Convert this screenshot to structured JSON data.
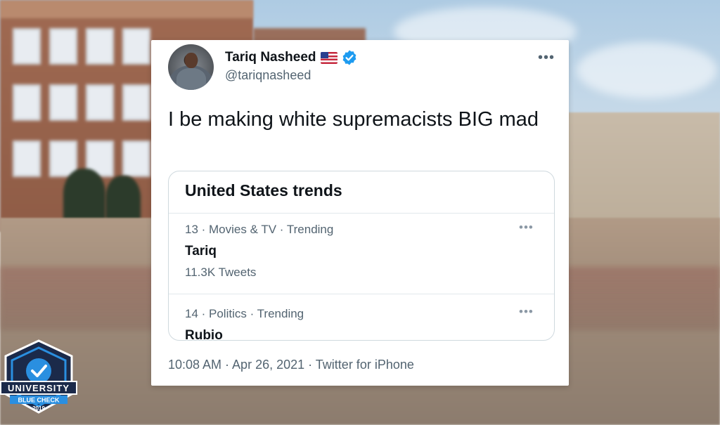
{
  "tweet": {
    "author_name": "Tariq Nasheed",
    "flag": "us-flag-icon",
    "verified": true,
    "handle": "@tariqnasheed",
    "more": "•••",
    "text": "I be making white supremacists BIG mad",
    "timestamp": "10:08 AM · Apr 26, 2021 · Twitter for iPhone"
  },
  "trends": {
    "title": "United States trends",
    "items": [
      {
        "meta": "13 · Movies & TV · Trending",
        "name": "Tariq",
        "count": "11.3K Tweets",
        "more": "•••"
      },
      {
        "meta": "14 · Politics · Trending",
        "name": "Rubio",
        "count": "",
        "more": "•••"
      }
    ]
  },
  "badge": {
    "line1": "UNIVERSITY",
    "line2": "BLUE CHECK",
    "year": "2019"
  },
  "colors": {
    "verified_blue": "#1d9bf0",
    "badge_navy": "#1b2a4a",
    "badge_blue": "#2a8fe0",
    "text_primary": "#0f1419",
    "text_secondary": "#536471"
  }
}
